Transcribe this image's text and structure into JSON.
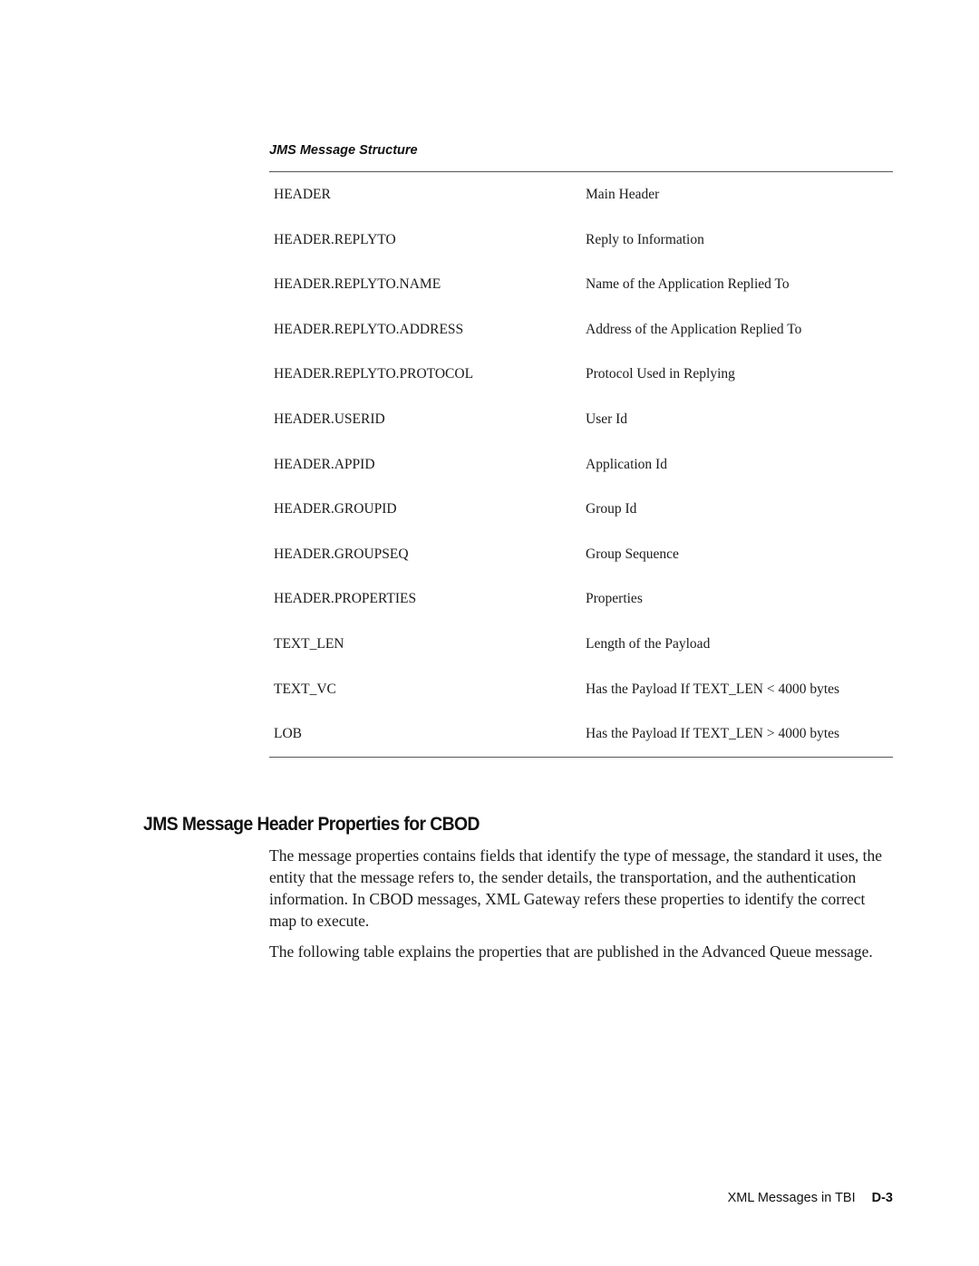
{
  "table": {
    "caption": "JMS Message Structure",
    "rows": [
      {
        "field": "HEADER",
        "description": "Main Header"
      },
      {
        "field": "HEADER.REPLYTO",
        "description": "Reply to Information"
      },
      {
        "field": "HEADER.REPLYTO.NAME",
        "description": "Name of the Application Replied To"
      },
      {
        "field": "HEADER.REPLYTO.ADDRESS",
        "description": "Address of the Application Replied To"
      },
      {
        "field": "HEADER.REPLYTO.PROTOCOL",
        "description": "Protocol Used in Replying"
      },
      {
        "field": "HEADER.USERID",
        "description": "User Id"
      },
      {
        "field": "HEADER.APPID",
        "description": "Application Id"
      },
      {
        "field": "HEADER.GROUPID",
        "description": "Group Id"
      },
      {
        "field": "HEADER.GROUPSEQ",
        "description": "Group Sequence"
      },
      {
        "field": "HEADER.PROPERTIES",
        "description": "Properties"
      },
      {
        "field": "TEXT_LEN",
        "description": "Length of the Payload"
      },
      {
        "field": "TEXT_VC",
        "description": "Has the Payload If TEXT_LEN < 4000 bytes"
      },
      {
        "field": "LOB",
        "description": "Has the Payload If TEXT_LEN > 4000 bytes"
      }
    ]
  },
  "section": {
    "heading": "JMS Message Header Properties for CBOD",
    "paragraphs": [
      "The message properties contains fields that identify the type of message, the standard it uses, the entity that the message refers to, the sender details, the transportation, and the authentication information. In CBOD messages, XML Gateway refers these properties to identify the correct map to execute.",
      "The following table explains the properties that are published in the Advanced Queue message."
    ]
  },
  "footer": {
    "chapter": "XML Messages in TBI",
    "page": "D-3"
  }
}
